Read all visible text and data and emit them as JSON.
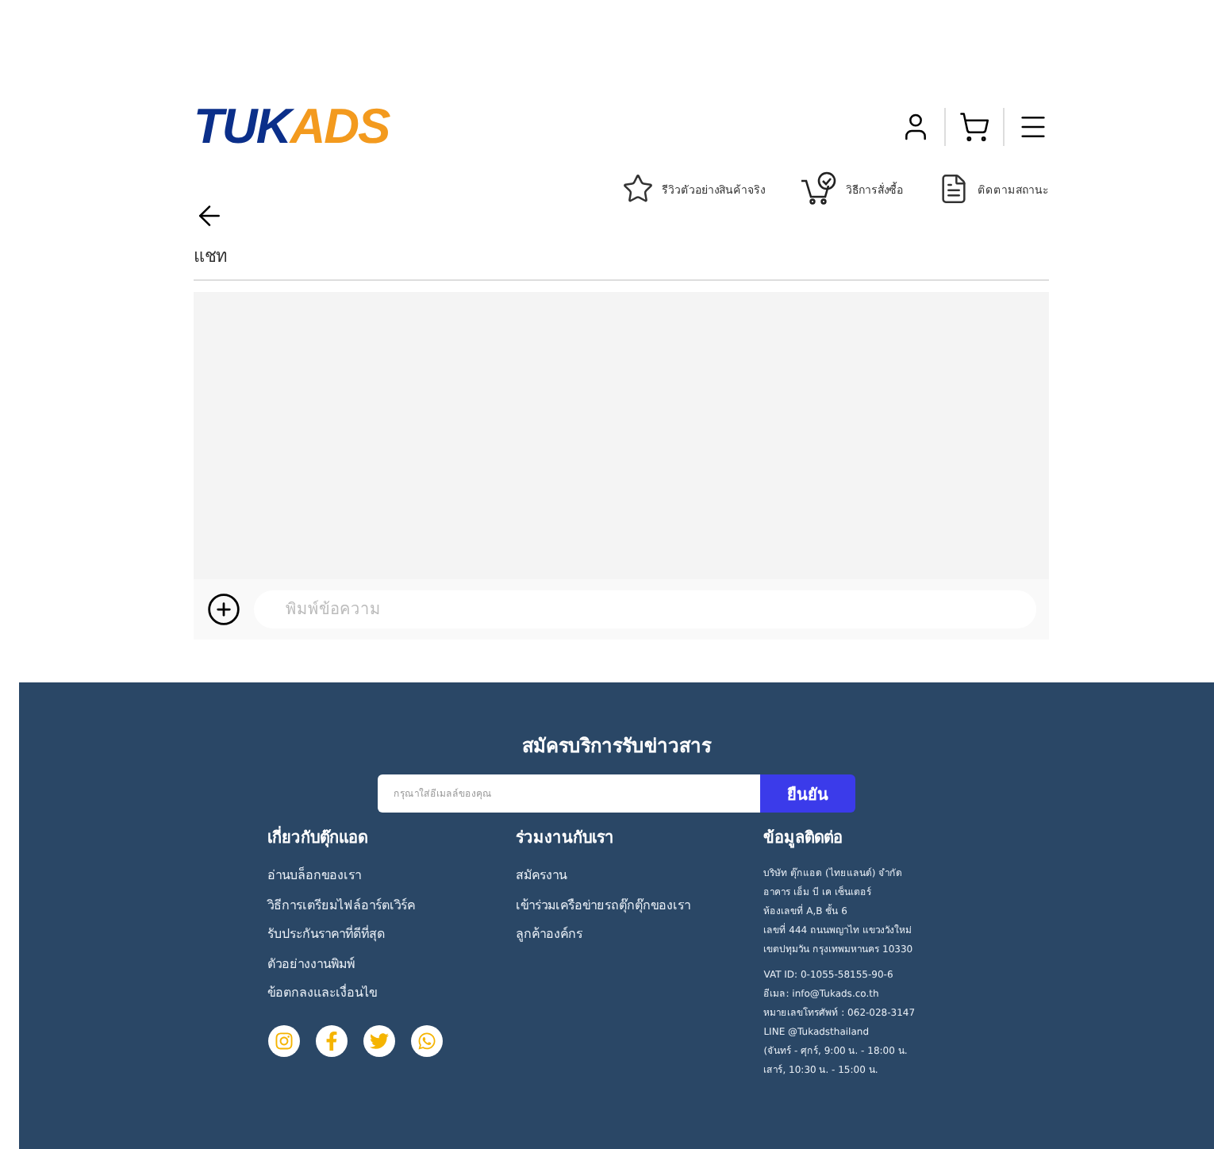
{
  "header": {
    "logo": {
      "primary": "TUK",
      "accent": "ADS"
    },
    "actions": [
      {
        "kind": "user"
      },
      {
        "kind": "cart"
      },
      {
        "kind": "menu"
      }
    ]
  },
  "nav": [
    {
      "kind": "star",
      "label": "รีวิวตัวอย่างสินค้าจริง"
    },
    {
      "kind": "cart-check",
      "label": "วิธีการสั่งซื้อ"
    },
    {
      "kind": "document",
      "label": "ติดตามสถานะ"
    }
  ],
  "chat": {
    "title": "แชท",
    "placeholder": "พิมพ์ข้อความ"
  },
  "footer": {
    "newsletter": {
      "title": "สมัครบริการรับข่าวสาร",
      "placeholder": "กรุณาใส่อีเมลล์ของคุณ",
      "button": "ยืนยัน"
    },
    "columns": [
      {
        "title": "เกี่ยวกับตุ๊กแอด",
        "links": [
          "อ่านบล็อกของเรา",
          "วิธีการเตรียมไฟล์อาร์ตเวิร์ค",
          "รับประกันราคาที่ดีที่สุด",
          "ตัวอย่างงานพิมพ์",
          "ข้อตกลงและเงื่อนไข"
        ]
      },
      {
        "title": "ร่วมงานกับเรา",
        "links": [
          "สมัครงาน",
          "เข้าร่วมเครือข่ายรถตุ๊กตุ๊กของเรา",
          "ลูกค้าองค์กร"
        ]
      }
    ],
    "socials": [
      {
        "kind": "instagram"
      },
      {
        "kind": "facebook"
      },
      {
        "kind": "twitter"
      },
      {
        "kind": "whatsapp"
      }
    ],
    "contact": {
      "title": "ข้อมูลติดต่อ",
      "groups": [
        [
          "บริษัท ตุ๊กแอด (ไทยแลนด์) จำกัด",
          "อาคาร เอ็ม บี เค เซ็นเตอร์",
          "ห้องเลขที่ A,B ชั้น 6",
          "เลขที่ 444 ถนนพญาไท แขวงวังใหม่",
          "เขตปทุมวัน กรุงเทพมหานคร 10330"
        ],
        [
          "VAT ID: 0-1055-58155-90-6",
          "อีเมล: info@Tukads.co.th",
          "หมายเลขโทรศัพท์ : 062-028-3147",
          "LINE @Tukadsthailand",
          "(จันทร์ - ศุกร์, 9:00 น. - 18:00 น.",
          "เสาร์, 10:30 น. - 15:00 น."
        ]
      ]
    }
  }
}
